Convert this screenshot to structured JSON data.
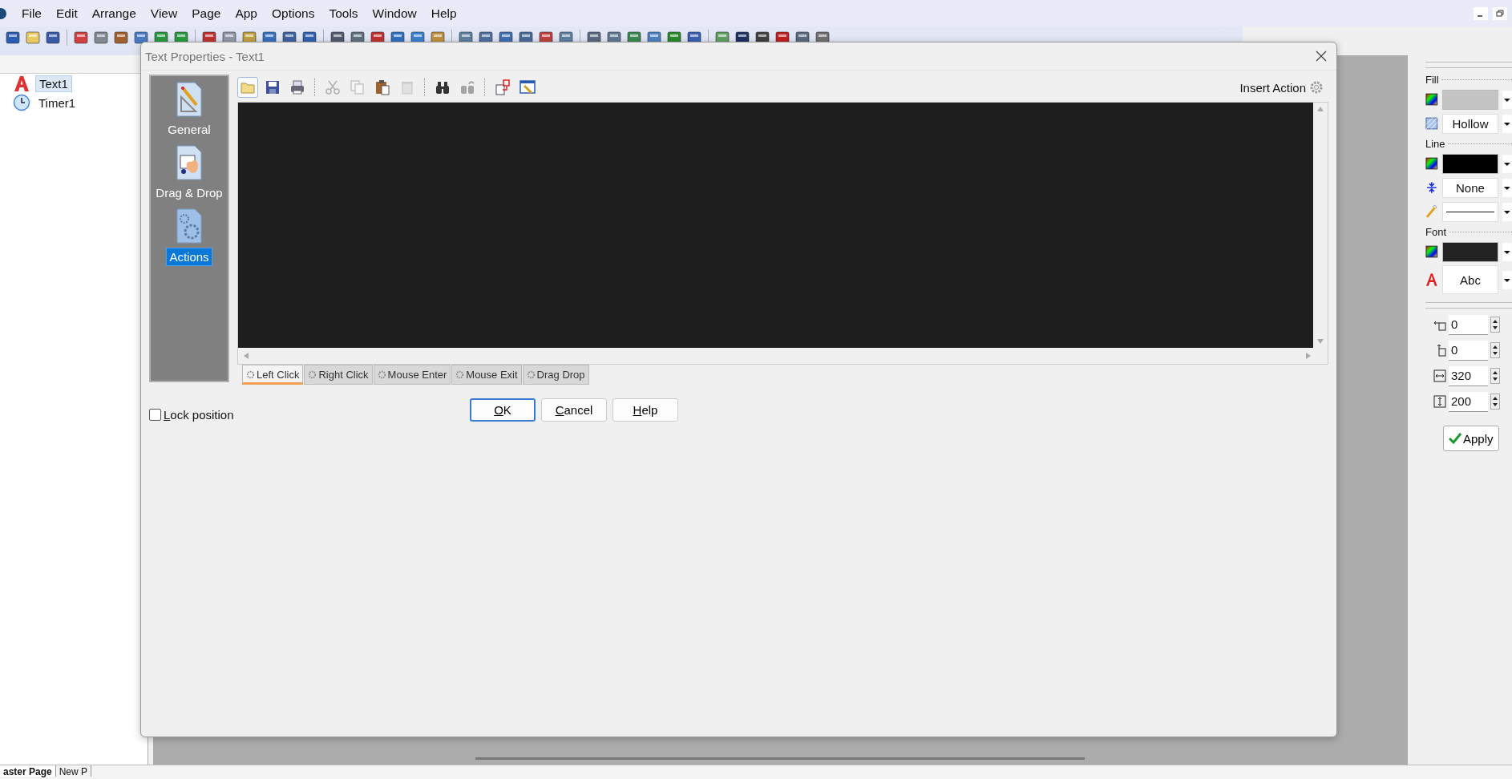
{
  "menu_bar": [
    "File",
    "Edit",
    "Arrange",
    "View",
    "Page",
    "App",
    "Options",
    "Tools",
    "Window",
    "Help"
  ],
  "tree": [
    {
      "label": "Text1",
      "kind": "text",
      "selected": true
    },
    {
      "label": "Timer1",
      "kind": "timer",
      "selected": false
    }
  ],
  "dialog": {
    "title": "Text Properties - Text1",
    "sidebar": [
      {
        "label": "General",
        "kind": "general",
        "selected": false
      },
      {
        "label": "Drag & Drop",
        "kind": "dragdrop",
        "selected": false
      },
      {
        "label": "Actions",
        "kind": "actions",
        "selected": true
      }
    ],
    "toolbar": [
      {
        "kind": "folder",
        "disabled": false
      },
      {
        "kind": "save",
        "disabled": false
      },
      {
        "kind": "print",
        "disabled": false
      },
      {
        "kind": "sep"
      },
      {
        "kind": "cut",
        "disabled": true
      },
      {
        "kind": "copy",
        "disabled": true
      },
      {
        "kind": "paste",
        "disabled": false
      },
      {
        "kind": "delete",
        "disabled": true
      },
      {
        "kind": "sep"
      },
      {
        "kind": "find",
        "disabled": false
      },
      {
        "kind": "replace",
        "disabled": true
      },
      {
        "kind": "sep"
      },
      {
        "kind": "insert",
        "disabled": false
      },
      {
        "kind": "edit",
        "disabled": false
      }
    ],
    "insert_action": "Insert Action",
    "event_tabs": [
      {
        "label": "Left Click",
        "selected": true
      },
      {
        "label": "Right Click",
        "selected": false
      },
      {
        "label": "Mouse Enter",
        "selected": false
      },
      {
        "label": "Mouse Exit",
        "selected": false
      },
      {
        "label": "Drag Drop",
        "selected": false
      }
    ],
    "lock_position": {
      "label": "Lock position",
      "checked": false
    },
    "buttons": [
      {
        "label": "OK",
        "default": true
      },
      {
        "label": "Cancel",
        "default": false
      },
      {
        "label": "Help",
        "default": false
      }
    ]
  },
  "properties": {
    "sections": [
      {
        "title": "Fill",
        "rows": [
          {
            "kind": "color",
            "color": "#c4c4c4"
          },
          {
            "kind": "pattern",
            "value": "Hollow"
          }
        ]
      },
      {
        "title": "Line",
        "rows": [
          {
            "kind": "color",
            "color": "#000000"
          },
          {
            "kind": "width",
            "value": "None"
          },
          {
            "kind": "style"
          }
        ]
      },
      {
        "title": "Font",
        "rows": [
          {
            "kind": "color",
            "color": "#222222"
          },
          {
            "kind": "font",
            "value": "Abc"
          }
        ]
      }
    ],
    "geometry": [
      {
        "kind": "left",
        "value": "0"
      },
      {
        "kind": "top",
        "value": "0"
      },
      {
        "kind": "width",
        "value": "320"
      },
      {
        "kind": "height",
        "value": "200"
      }
    ],
    "apply": "Apply"
  },
  "page_tabs": [
    {
      "label": "aster Page",
      "selected": true
    },
    {
      "label": "New P",
      "selected": false
    }
  ]
}
